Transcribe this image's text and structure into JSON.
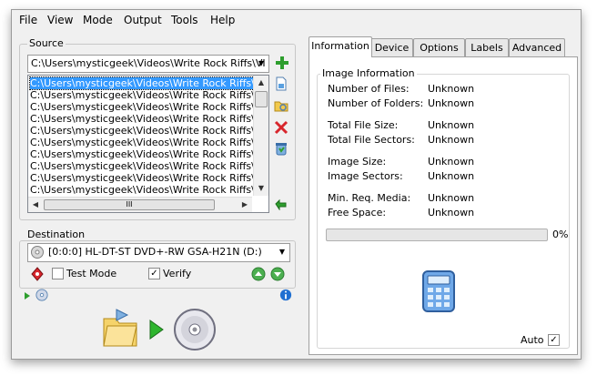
{
  "menu": [
    "File",
    "View",
    "Mode",
    "Output",
    "Tools",
    "Help"
  ],
  "source": {
    "title": "Source",
    "path": "C:\\Users\\mysticgeek\\Videos\\Write Rock Riffs\\VI",
    "files": [
      "C:\\Users\\mysticgeek\\Videos\\Write Rock Riffs\\VI",
      "C:\\Users\\mysticgeek\\Videos\\Write Rock Riffs\\VI",
      "C:\\Users\\mysticgeek\\Videos\\Write Rock Riffs\\VI",
      "C:\\Users\\mysticgeek\\Videos\\Write Rock Riffs\\VI",
      "C:\\Users\\mysticgeek\\Videos\\Write Rock Riffs\\VI",
      "C:\\Users\\mysticgeek\\Videos\\Write Rock Riffs\\VI",
      "C:\\Users\\mysticgeek\\Videos\\Write Rock Riffs\\VI",
      "C:\\Users\\mysticgeek\\Videos\\Write Rock Riffs\\VI",
      "C:\\Users\\mysticgeek\\Videos\\Write Rock Riffs\\VI",
      "C:\\Users\\mysticgeek\\Videos\\Write Rock Riffs\\VI"
    ],
    "scroll_grip": "III"
  },
  "destination": {
    "title": "Destination",
    "drive": "[0:0:0] HL-DT-ST DVD+-RW GSA-H21N (D:)",
    "test_mode_label": "Test Mode",
    "test_mode_checked": false,
    "verify_label": "Verify",
    "verify_checked": true
  },
  "tabs": [
    "Information",
    "Device",
    "Options",
    "Labels",
    "Advanced"
  ],
  "info": {
    "section_title": "Image Information",
    "rows": [
      {
        "label": "Number of Files:",
        "value": "Unknown"
      },
      {
        "label": "Number of Folders:",
        "value": "Unknown"
      },
      {
        "label": "Total File Size:",
        "value": "Unknown"
      },
      {
        "label": "Total File Sectors:",
        "value": "Unknown"
      },
      {
        "label": "Image Size:",
        "value": "Unknown"
      },
      {
        "label": "Image Sectors:",
        "value": "Unknown"
      },
      {
        "label": "Min. Req. Media:",
        "value": "Unknown"
      },
      {
        "label": "Free Space:",
        "value": "Unknown"
      }
    ],
    "progress_value": 0,
    "progress_text": "0%",
    "auto_label": "Auto",
    "auto_checked": true
  },
  "check_mark": "✓",
  "colors": {
    "selection": "#3399ff",
    "accent_green": "#2e9e2e"
  }
}
